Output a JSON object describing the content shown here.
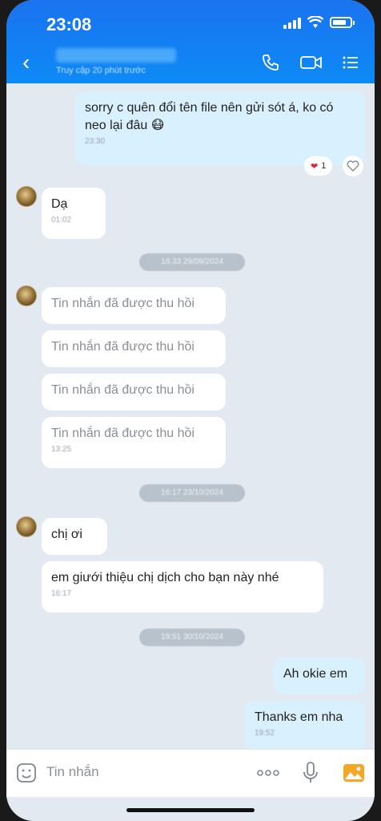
{
  "status": {
    "time": "23:08"
  },
  "header": {
    "back_label": "‹",
    "contact_subtitle": "Truy cập 20 phút trước",
    "icons": [
      "phone-icon",
      "video-icon",
      "menu-icon"
    ]
  },
  "messages": {
    "m1": {
      "text": "sorry c quên đổi tên file nên gửi sót á, ko có neo lại đâu 😷",
      "time": "23:30"
    },
    "m1_reaction": {
      "emoji": "❤",
      "count": "1"
    },
    "m2": {
      "text": "Dạ",
      "time": "01:02"
    },
    "date1": "18:33 29/09/2024",
    "recalled": [
      {
        "text": "Tin nhắn đã được thu hồi",
        "time": ""
      },
      {
        "text": "Tin nhắn đã được thu hồi",
        "time": ""
      },
      {
        "text": "Tin nhắn đã được thu hồi",
        "time": ""
      },
      {
        "text": "Tin nhắn đã được thu hồi",
        "time": "13:25"
      }
    ],
    "date2": "16:17 23/10/2024",
    "m3": {
      "text": "chị ơi",
      "time": ""
    },
    "m4": {
      "text": "em giưới thiệu chị dịch cho bạn này nhé",
      "time": "16:17"
    },
    "date3": "19:51 30/10/2024",
    "m5": {
      "text": "Ah okie em",
      "time": ""
    },
    "m6": {
      "text": "Thanks em nha",
      "time": "19:52"
    }
  },
  "input": {
    "placeholder": "Tin nhắn"
  },
  "colors": {
    "header": "#1a73f0",
    "mine_bubble": "#d9f0fe",
    "background": "#e2e9f1"
  }
}
